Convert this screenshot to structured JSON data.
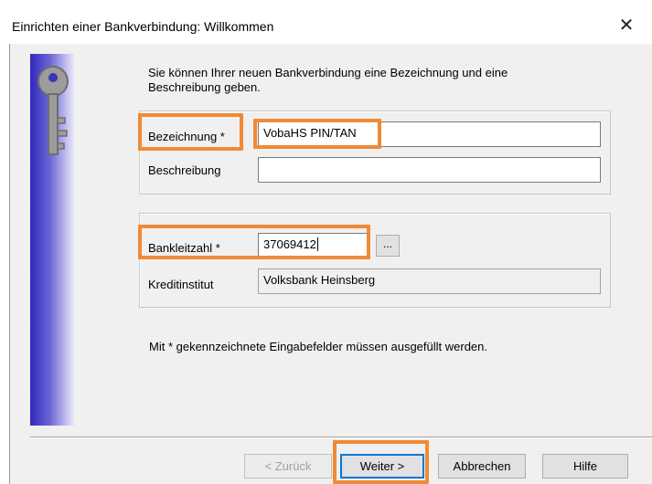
{
  "window": {
    "title": "Einrichten einer Bankverbindung: Willkommen",
    "close_icon": "close-icon"
  },
  "intro_text": "Sie können Ihrer neuen Bankverbindung eine Bezeichnung und eine Beschreibung geben.",
  "name_group": {
    "bezeichnung_label": "Bezeichnung *",
    "bezeichnung_value": "VobaHS PIN/TAN",
    "beschreibung_label": "Beschreibung",
    "beschreibung_value": ""
  },
  "bank_group": {
    "blz_label": "Bankleitzahl *",
    "blz_value": "37069412",
    "browse_label": "...",
    "institut_label": "Kreditinstitut",
    "institut_value": "Volksbank Heinsberg"
  },
  "required_note": "Mit * gekennzeichnete Eingabefelder müssen ausgefüllt werden.",
  "buttons": {
    "back": "< Zurück",
    "next": "Weiter >",
    "cancel": "Abbrechen",
    "help": "Hilfe"
  },
  "colors": {
    "highlight": "#f08a36",
    "banner_dark": "#2f2ab8",
    "banner_light": "#e8e7f9",
    "focus_border": "#0078d7"
  }
}
